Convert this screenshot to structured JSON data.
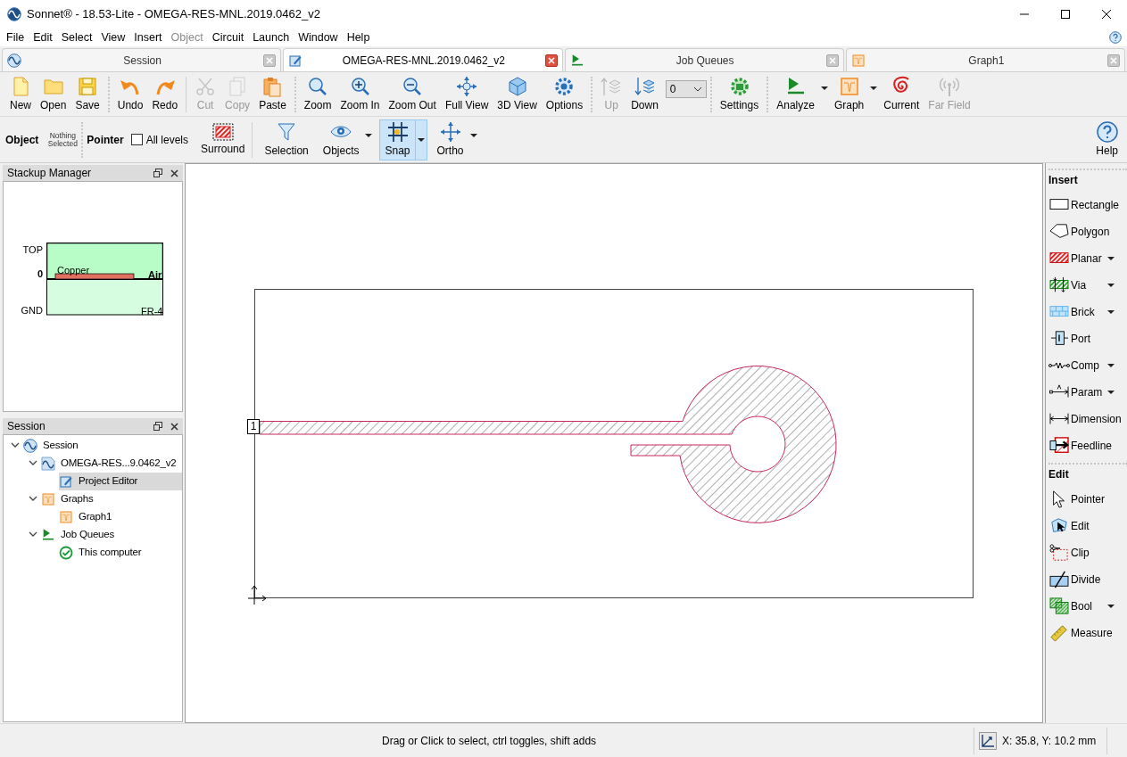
{
  "window": {
    "title": "Sonnet® - 18.53-Lite - OMEGA-RES-MNL.2019.0462_v2"
  },
  "menu": [
    {
      "label": "File",
      "disabled": false
    },
    {
      "label": "Edit",
      "disabled": false
    },
    {
      "label": "Select",
      "disabled": false
    },
    {
      "label": "View",
      "disabled": false
    },
    {
      "label": "Insert",
      "disabled": false
    },
    {
      "label": "Object",
      "disabled": true
    },
    {
      "label": "Circuit",
      "disabled": false
    },
    {
      "label": "Launch",
      "disabled": false
    },
    {
      "label": "Window",
      "disabled": false
    },
    {
      "label": "Help",
      "disabled": false
    }
  ],
  "tabs": [
    {
      "label": "Session",
      "selected": false
    },
    {
      "label": "OMEGA-RES-MNL.2019.0462_v2",
      "selected": true
    },
    {
      "label": "Job Queues",
      "selected": false
    },
    {
      "label": "Graph1",
      "selected": false
    }
  ],
  "toolbar": [
    [
      {
        "kind": "button",
        "label": "New",
        "disabled": false
      },
      {
        "kind": "button",
        "label": "Open",
        "disabled": false
      },
      {
        "kind": "button",
        "label": "Save",
        "disabled": false
      }
    ],
    [
      {
        "kind": "button",
        "label": "Undo",
        "disabled": false
      },
      {
        "kind": "button",
        "label": "Redo",
        "disabled": false
      }
    ],
    [
      {
        "kind": "button",
        "label": "Cut",
        "disabled": true
      },
      {
        "kind": "button",
        "label": "Copy",
        "disabled": true
      },
      {
        "kind": "button",
        "label": "Paste",
        "disabled": false
      }
    ],
    [
      {
        "kind": "button",
        "label": "Zoom",
        "disabled": false
      },
      {
        "kind": "button",
        "label": "Zoom In",
        "disabled": false
      },
      {
        "kind": "button",
        "label": "Zoom Out",
        "disabled": false
      },
      {
        "kind": "button",
        "label": "Full View",
        "disabled": false
      },
      {
        "kind": "button",
        "label": "3D View",
        "disabled": false
      },
      {
        "kind": "button",
        "label": "Options",
        "disabled": false
      }
    ],
    [
      {
        "kind": "button",
        "label": "Up",
        "disabled": true
      },
      {
        "kind": "button",
        "label": "Down",
        "disabled": false
      },
      {
        "kind": "select",
        "value": "0"
      }
    ],
    [
      {
        "kind": "button",
        "label": "Settings",
        "disabled": false
      }
    ],
    [
      {
        "kind": "button",
        "label": "Analyze",
        "disabled": false,
        "dropdown": true
      },
      {
        "kind": "button",
        "label": "Graph",
        "disabled": false,
        "dropdown": true
      },
      {
        "kind": "button",
        "label": "Current",
        "disabled": false
      },
      {
        "kind": "button",
        "label": "Far Field",
        "disabled": true
      }
    ]
  ],
  "mode_bar": {
    "object_label": "Object",
    "selection_status": "Nothing Selected",
    "tool_label": "Pointer",
    "all_levels": {
      "label": "All levels",
      "checked": false
    },
    "surround": "Surround",
    "buttons": [
      {
        "label": "Selection",
        "dropdown": false,
        "selected": false
      },
      {
        "label": "Objects",
        "dropdown": true,
        "selected": false
      },
      {
        "label": "Snap",
        "dropdown": true,
        "selected": true
      },
      {
        "label": "Ortho",
        "dropdown": true,
        "selected": false
      }
    ],
    "help": "Help"
  },
  "stackup_manager": {
    "title": "Stackup Manager",
    "layer_labels": [
      "TOP",
      "0",
      "GND"
    ],
    "metal": "Copper",
    "upper_dielectric": "Air",
    "lower_dielectric": "FR-4"
  },
  "session": {
    "title": "Session",
    "tree": [
      {
        "label": "Session",
        "expanded": true,
        "selected": false,
        "children": [
          {
            "label": "OMEGA-RES...9.0462_v2",
            "expanded": true,
            "selected": false,
            "children": [
              {
                "label": "Project Editor",
                "selected": true
              }
            ]
          },
          {
            "label": "Graphs",
            "expanded": true,
            "selected": false,
            "children": [
              {
                "label": "Graph1",
                "selected": false
              }
            ]
          },
          {
            "label": "Job Queues",
            "expanded": true,
            "selected": false,
            "children": [
              {
                "label": "This computer",
                "selected": false
              }
            ]
          }
        ]
      }
    ]
  },
  "canvas": {
    "port_label": "1"
  },
  "tool_panel": [
    {
      "title": "Insert",
      "items": [
        {
          "label": "Rectangle",
          "dropdown": false
        },
        {
          "label": "Polygon",
          "dropdown": false
        },
        {
          "label": "Planar",
          "dropdown": true
        },
        {
          "label": "Via",
          "dropdown": true
        },
        {
          "label": "Brick",
          "dropdown": true
        },
        {
          "label": "Port",
          "dropdown": false
        },
        {
          "label": "Comp",
          "dropdown": true
        },
        {
          "label": "Param",
          "dropdown": true
        },
        {
          "label": "Dimension",
          "dropdown": false
        },
        {
          "label": "Feedline",
          "dropdown": false
        }
      ]
    },
    {
      "title": "Edit",
      "items": [
        {
          "label": "Pointer",
          "dropdown": false
        },
        {
          "label": "Edit",
          "dropdown": false
        },
        {
          "label": "Clip",
          "dropdown": false
        },
        {
          "label": "Divide",
          "dropdown": false
        },
        {
          "label": "Bool",
          "dropdown": true
        },
        {
          "label": "Measure",
          "dropdown": false
        }
      ]
    }
  ],
  "status_bar": {
    "message": "Drag or Click to select, ctrl toggles, shift adds",
    "coordinates": "X: 35.8, Y: 10.2 mm"
  }
}
